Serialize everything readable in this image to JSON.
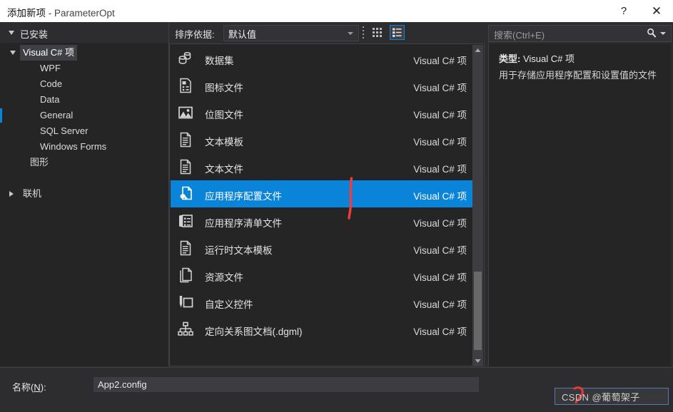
{
  "window": {
    "title_main": "添加新项",
    "title_sep": " - ",
    "title_project": "ParameterOpt",
    "help_label": "?",
    "close_label": "✕"
  },
  "left_pane": {
    "header": "已安装",
    "tree": [
      {
        "label": "Visual C# 项",
        "level": 0,
        "expanded": true,
        "selected": true
      },
      {
        "label": "WPF",
        "level": 1,
        "expanded": false,
        "selected": false
      },
      {
        "label": "Code",
        "level": 1,
        "expanded": false,
        "selected": false
      },
      {
        "label": "Data",
        "level": 1,
        "expanded": false,
        "selected": false
      },
      {
        "label": "General",
        "level": 1,
        "expanded": false,
        "selected": false
      },
      {
        "label": "SQL Server",
        "level": 1,
        "expanded": false,
        "selected": false
      },
      {
        "label": "Windows Forms",
        "level": 1,
        "expanded": false,
        "selected": false
      },
      {
        "label": "图形",
        "level": 2,
        "expanded": false,
        "selected": false
      },
      {
        "label": "联机",
        "level": 3,
        "expanded": false,
        "selected": false
      }
    ]
  },
  "toolbar": {
    "sort_label": "排序依据:",
    "sort_value": "默认值",
    "view_grid_icon": "grid-view-icon",
    "view_list_icon": "list-view-icon"
  },
  "search": {
    "placeholder": "搜索(Ctrl+E)",
    "value": "",
    "icon": "search-icon"
  },
  "list": {
    "items": [
      {
        "name": "数据集",
        "kind": "Visual C# 项",
        "icon": "dataset-icon",
        "selected": false
      },
      {
        "name": "图标文件",
        "kind": "Visual C# 项",
        "icon": "icon-file-icon",
        "selected": false
      },
      {
        "name": "位图文件",
        "kind": "Visual C# 项",
        "icon": "bitmap-file-icon",
        "selected": false
      },
      {
        "name": "文本模板",
        "kind": "Visual C# 项",
        "icon": "text-template-icon",
        "selected": false
      },
      {
        "name": "文本文件",
        "kind": "Visual C# 项",
        "icon": "text-file-icon",
        "selected": false
      },
      {
        "name": "应用程序配置文件",
        "kind": "Visual C# 项",
        "icon": "app-config-file-icon",
        "selected": true
      },
      {
        "name": "应用程序清单文件",
        "kind": "Visual C# 项",
        "icon": "app-manifest-file-icon",
        "selected": false
      },
      {
        "name": "运行时文本模板",
        "kind": "Visual C# 项",
        "icon": "runtime-text-template-icon",
        "selected": false
      },
      {
        "name": "资源文件",
        "kind": "Visual C# 项",
        "icon": "resource-file-icon",
        "selected": false
      },
      {
        "name": "自定义控件",
        "kind": "Visual C# 项",
        "icon": "custom-control-icon",
        "selected": false
      },
      {
        "name": "定向关系图文档(.dgml)",
        "kind": "Visual C# 项",
        "icon": "directed-graph-doc-icon",
        "selected": false
      }
    ]
  },
  "info": {
    "type_label": "类型:",
    "type_value": "Visual C# 项",
    "description": "用于存储应用程序配置和设置值的文件"
  },
  "bottom": {
    "name_label_pre": "名称(",
    "name_label_key": "N",
    "name_label_post": "):",
    "name_value": "App2.config"
  },
  "annotation": {
    "line_color": "#f13c3c",
    "watermark_text": "CSDN @葡萄架子"
  },
  "colors": {
    "accent": "#0a84d8",
    "window_bg": "#2d2d30",
    "pane_bg": "#252526"
  }
}
